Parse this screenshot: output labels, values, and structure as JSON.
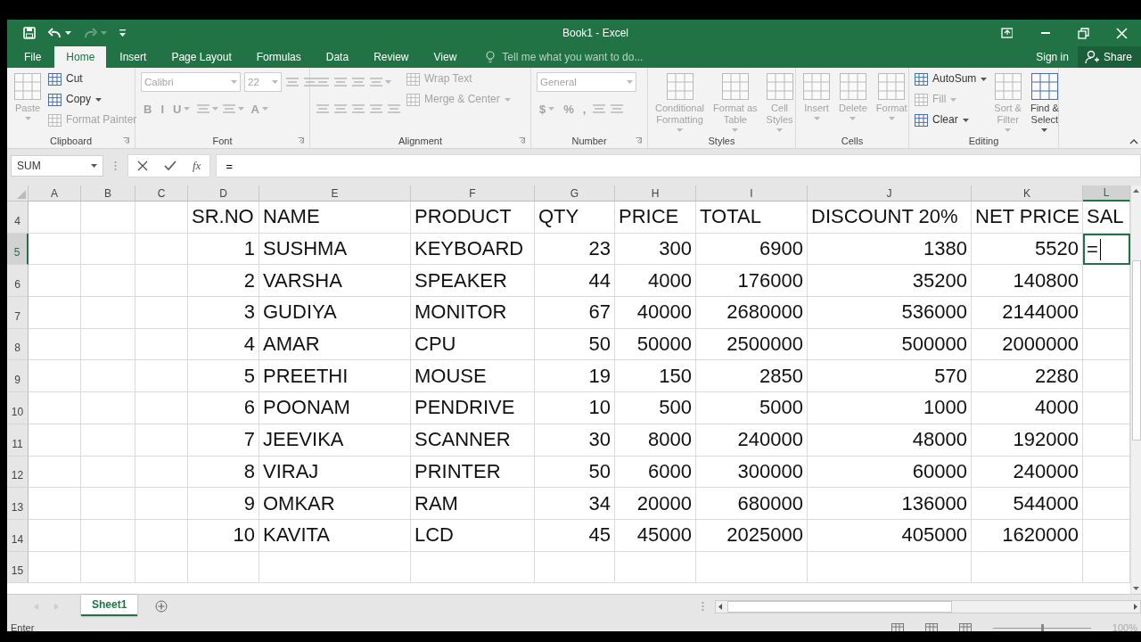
{
  "window": {
    "title": "Book1 - Excel"
  },
  "quick_access": [
    {
      "kind": "save",
      "disabled": false,
      "caret": false
    },
    {
      "kind": "undo",
      "disabled": false,
      "caret": true
    },
    {
      "kind": "redo",
      "disabled": true,
      "caret": true
    },
    {
      "kind": "customize",
      "disabled": false,
      "caret": false
    }
  ],
  "tabs": [
    {
      "label": "File",
      "selected": false
    },
    {
      "label": "Home",
      "selected": true
    },
    {
      "label": "Insert",
      "selected": false
    },
    {
      "label": "Page Layout",
      "selected": false
    },
    {
      "label": "Formulas",
      "selected": false
    },
    {
      "label": "Data",
      "selected": false
    },
    {
      "label": "Review",
      "selected": false
    },
    {
      "label": "View",
      "selected": false
    }
  ],
  "tell_me": {
    "placeholder": "Tell me what you want to do..."
  },
  "sign_in": "Sign in",
  "share": "Share",
  "ribbon": [
    {
      "label": "Clipboard",
      "launcher": true,
      "columns": [
        [
          {
            "kind": "large",
            "label": "Paste",
            "disabled": true,
            "caret": true
          }
        ],
        [
          {
            "kind": "small",
            "label": "Cut",
            "disabled": false,
            "caret": false
          },
          {
            "kind": "small",
            "label": "Copy",
            "disabled": false,
            "caret": true
          },
          {
            "kind": "small",
            "label": "Format Painter",
            "disabled": true,
            "caret": false
          }
        ]
      ]
    },
    {
      "label": "Font",
      "launcher": true,
      "columns": [
        [
          {
            "kind": "strip",
            "items": [
              {
                "kind": "field",
                "label": "Calibri",
                "disabled": true,
                "caret": true,
                "wide": true
              },
              {
                "kind": "field",
                "label": "22",
                "disabled": true,
                "caret": true,
                "wide": false
              },
              {
                "kind": "icon",
                "disabled": true,
                "caret": false
              },
              {
                "kind": "icon",
                "disabled": true,
                "caret": false
              }
            ]
          },
          {
            "kind": "strip",
            "items": [
              {
                "kind": "glyph",
                "label": "B",
                "disabled": true,
                "caret": false
              },
              {
                "kind": "glyph",
                "label": "I",
                "disabled": true,
                "caret": false
              },
              {
                "kind": "glyph",
                "label": "U",
                "disabled": true,
                "caret": true
              },
              {
                "kind": "icon",
                "disabled": true,
                "caret": true
              },
              {
                "kind": "icon",
                "disabled": true,
                "caret": true
              },
              {
                "kind": "glyph",
                "label": "A",
                "disabled": true,
                "caret": true
              }
            ]
          }
        ]
      ]
    },
    {
      "label": "Alignment",
      "launcher": true,
      "columns": [
        [
          {
            "kind": "strip",
            "items": [
              {
                "kind": "icon",
                "disabled": true,
                "caret": false
              },
              {
                "kind": "icon",
                "disabled": true,
                "caret": false
              },
              {
                "kind": "icon",
                "disabled": true,
                "caret": false
              },
              {
                "kind": "icon",
                "disabled": true,
                "caret": true
              }
            ]
          },
          {
            "kind": "strip",
            "items": [
              {
                "kind": "icon",
                "disabled": true,
                "caret": false
              },
              {
                "kind": "icon",
                "disabled": true,
                "caret": false
              },
              {
                "kind": "icon",
                "disabled": true,
                "caret": false
              },
              {
                "kind": "icon",
                "disabled": true,
                "caret": false
              },
              {
                "kind": "icon",
                "disabled": true,
                "caret": false
              }
            ]
          }
        ],
        [
          {
            "kind": "small",
            "label": "Wrap Text",
            "disabled": true,
            "caret": false
          },
          {
            "kind": "small",
            "label": "Merge & Center",
            "disabled": true,
            "caret": true
          }
        ]
      ]
    },
    {
      "label": "Number",
      "launcher": true,
      "columns": [
        [
          {
            "kind": "strip",
            "items": [
              {
                "kind": "field",
                "label": "General",
                "disabled": true,
                "caret": true,
                "wide": true
              }
            ]
          },
          {
            "kind": "strip",
            "items": [
              {
                "kind": "glyph",
                "label": "$",
                "disabled": true,
                "caret": true
              },
              {
                "kind": "glyph",
                "label": "%",
                "disabled": true,
                "caret": false
              },
              {
                "kind": "glyph",
                "label": ",",
                "disabled": true,
                "caret": false
              },
              {
                "kind": "icon",
                "disabled": true,
                "caret": false
              },
              {
                "kind": "icon",
                "disabled": true,
                "caret": false
              }
            ]
          }
        ]
      ]
    },
    {
      "label": "Styles",
      "launcher": false,
      "columns": [
        [
          {
            "kind": "large",
            "label": "Conditional\nFormatting",
            "disabled": true,
            "caret": true
          }
        ],
        [
          {
            "kind": "large",
            "label": "Format as\nTable",
            "disabled": true,
            "caret": true
          }
        ],
        [
          {
            "kind": "large",
            "label": "Cell\nStyles",
            "disabled": true,
            "caret": true
          }
        ]
      ]
    },
    {
      "label": "Cells",
      "launcher": false,
      "columns": [
        [
          {
            "kind": "large",
            "label": "Insert",
            "disabled": true,
            "caret": true
          }
        ],
        [
          {
            "kind": "large",
            "label": "Delete",
            "disabled": true,
            "caret": true
          }
        ],
        [
          {
            "kind": "large",
            "label": "Format",
            "disabled": true,
            "caret": true
          }
        ]
      ]
    },
    {
      "label": "Editing",
      "launcher": false,
      "columns": [
        [
          {
            "kind": "small",
            "label": "AutoSum",
            "disabled": false,
            "caret": true
          },
          {
            "kind": "small",
            "label": "Fill",
            "disabled": true,
            "caret": true
          },
          {
            "kind": "small",
            "label": "Clear",
            "disabled": false,
            "caret": true
          }
        ],
        [
          {
            "kind": "large",
            "label": "Sort &\nFilter",
            "disabled": true,
            "caret": true
          }
        ],
        [
          {
            "kind": "large",
            "label": "Find &\nSelect",
            "disabled": false,
            "caret": true
          }
        ]
      ]
    }
  ],
  "name_box": "SUM",
  "fx_label": "fx",
  "formula": "=",
  "columns": [
    {
      "label": "A",
      "selected": false
    },
    {
      "label": "B",
      "selected": false
    },
    {
      "label": "C",
      "selected": false
    },
    {
      "label": "D",
      "numeric": true,
      "selected": false
    },
    {
      "label": "E",
      "numeric": false,
      "selected": false
    },
    {
      "label": "F",
      "numeric": false,
      "selected": false
    },
    {
      "label": "G",
      "numeric": true,
      "selected": false
    },
    {
      "label": "H",
      "numeric": true,
      "selected": false
    },
    {
      "label": "I",
      "numeric": true,
      "selected": false
    },
    {
      "label": "J",
      "numeric": true,
      "selected": false
    },
    {
      "label": "K",
      "numeric": true,
      "selected": false
    },
    {
      "label": "L",
      "numeric": false,
      "selected": true
    }
  ],
  "rows": [
    {
      "number": "4",
      "kind": "header",
      "selected": false,
      "cells": {
        "D": "SR.NO",
        "E": "NAME",
        "F": "PRODUCT",
        "G": "QTY",
        "H": "PRICE",
        "I": "TOTAL",
        "J": "DISCOUNT 20%",
        "K": "NET PRICE",
        "L": "SAL"
      }
    },
    {
      "number": "5",
      "kind": "data",
      "selected": true,
      "cells": {
        "D": "1",
        "E": "SUSHMA",
        "F": "KEYBOARD",
        "G": "23",
        "H": "300",
        "I": "6900",
        "J": "1380",
        "K": "5520",
        "L": "="
      }
    },
    {
      "number": "6",
      "kind": "data",
      "selected": false,
      "cells": {
        "D": "2",
        "E": "VARSHA",
        "F": "SPEAKER",
        "G": "44",
        "H": "4000",
        "I": "176000",
        "J": "35200",
        "K": "140800"
      }
    },
    {
      "number": "7",
      "kind": "data",
      "selected": false,
      "cells": {
        "D": "3",
        "E": "GUDIYA",
        "F": "MONITOR",
        "G": "67",
        "H": "40000",
        "I": "2680000",
        "J": "536000",
        "K": "2144000"
      }
    },
    {
      "number": "8",
      "kind": "data",
      "selected": false,
      "cells": {
        "D": "4",
        "E": "AMAR",
        "F": "CPU",
        "G": "50",
        "H": "50000",
        "I": "2500000",
        "J": "500000",
        "K": "2000000"
      }
    },
    {
      "number": "9",
      "kind": "data",
      "selected": false,
      "cells": {
        "D": "5",
        "E": "PREETHI",
        "F": "MOUSE",
        "G": "19",
        "H": "150",
        "I": "2850",
        "J": "570",
        "K": "2280"
      }
    },
    {
      "number": "10",
      "kind": "data",
      "selected": false,
      "cells": {
        "D": "6",
        "E": "POONAM",
        "F": "PENDRIVE",
        "G": "10",
        "H": "500",
        "I": "5000",
        "J": "1000",
        "K": "4000"
      }
    },
    {
      "number": "11",
      "kind": "data",
      "selected": false,
      "cells": {
        "D": "7",
        "E": "JEEVIKA",
        "F": "SCANNER",
        "G": "30",
        "H": "8000",
        "I": "240000",
        "J": "48000",
        "K": "192000"
      }
    },
    {
      "number": "12",
      "kind": "data",
      "selected": false,
      "cells": {
        "D": "8",
        "E": "VIRAJ",
        "F": "PRINTER",
        "G": "50",
        "H": "6000",
        "I": "300000",
        "J": "60000",
        "K": "240000"
      }
    },
    {
      "number": "13",
      "kind": "data",
      "selected": false,
      "cells": {
        "D": "9",
        "E": "OMKAR",
        "F": "RAM",
        "G": "34",
        "H": "20000",
        "I": "680000",
        "J": "136000",
        "K": "544000"
      }
    },
    {
      "number": "14",
      "kind": "data",
      "selected": false,
      "cells": {
        "D": "10",
        "E": "KAVITA",
        "F": "LCD",
        "G": "45",
        "H": "45000",
        "I": "2025000",
        "J": "405000",
        "K": "1620000"
      }
    },
    {
      "number": "15",
      "kind": "data",
      "selected": false,
      "cells": {}
    }
  ],
  "sheet_tabs": [
    {
      "label": "Sheet1",
      "selected": true
    }
  ],
  "status_bar": {
    "mode": "Enter",
    "zoom_slider": {
      "level": 0.5
    },
    "zoom": "100%"
  }
}
